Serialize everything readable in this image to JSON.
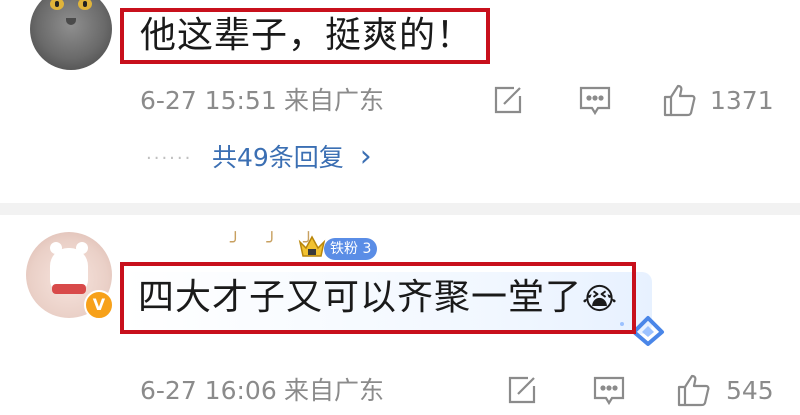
{
  "comment1": {
    "text": "他这辈子，挺爽的！",
    "date": "6-27 15:51",
    "source": "来自广东",
    "like_count": "1371",
    "replies_label": "共49条回复",
    "replies_dots": "······",
    "replies_chevron": "›"
  },
  "comment2": {
    "text": "四大才子又可以齐聚一堂了",
    "emoji": "😭",
    "badge": "铁粉 3",
    "verified_mark": "V",
    "name_decor": "╯ ╯ ╯",
    "date": "6-27 16:06",
    "source": "来自广东",
    "like_count": "545"
  },
  "icons": {
    "edit": "edit-icon",
    "comment": "comment-icon",
    "like": "like-icon"
  },
  "colors": {
    "highlight_border": "#c8101c",
    "reply_link": "#3b6fb3",
    "meta_text": "#8b8b8b",
    "fan_badge": "#5a8de6",
    "verified": "#f7a11a"
  }
}
